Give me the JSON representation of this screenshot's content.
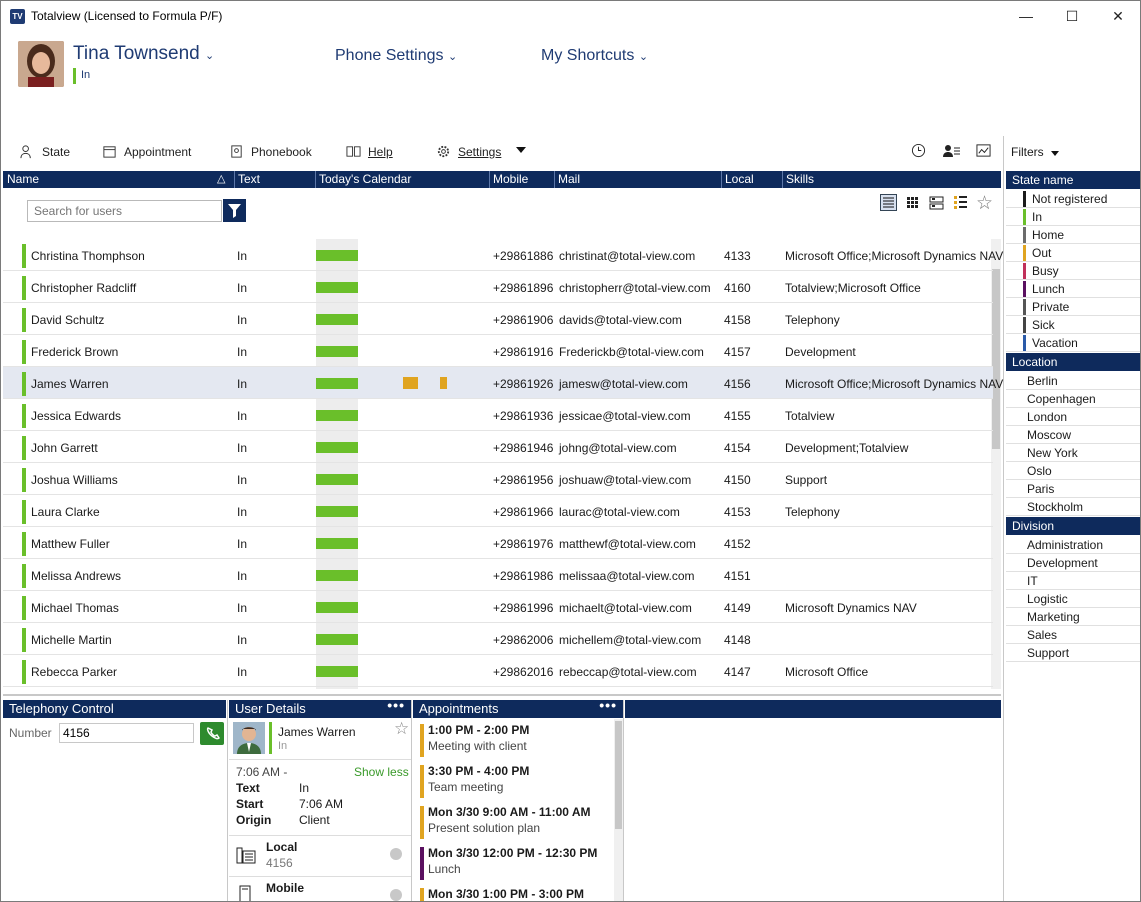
{
  "window": {
    "title": "Totalview  (Licensed to Formula P/F)",
    "icon_label": "TV",
    "minimize": "—",
    "maximize": "☐",
    "close": "✕"
  },
  "header": {
    "user_name": "Tina Townsend",
    "user_status": "In",
    "phone_settings": "Phone Settings",
    "my_shortcuts": "My Shortcuts"
  },
  "toolbar": {
    "state": "State",
    "appointment": "Appointment",
    "phonebook": "Phonebook",
    "help": "Help",
    "settings": "Settings",
    "filters": "Filters"
  },
  "grid": {
    "columns": [
      "Name",
      "Text",
      "Today's Calendar",
      "Mobile",
      "Mail",
      "Local",
      "Skills"
    ],
    "search_placeholder": "Search for users",
    "rows": [
      {
        "name": "Christina Thomphson",
        "text": "In",
        "mobile": "+29861886",
        "mail": "christinat@total-view.com",
        "local": "4133",
        "skills": "Microsoft Office;Microsoft Dynamics NAV"
      },
      {
        "name": "Christopher Radcliff",
        "text": "In",
        "mobile": "+29861896",
        "mail": "christopherr@total-view.com",
        "local": "4160",
        "skills": "Totalview;Microsoft Office"
      },
      {
        "name": "David Schultz",
        "text": "In",
        "mobile": "+29861906",
        "mail": "davids@total-view.com",
        "local": "4158",
        "skills": "Telephony"
      },
      {
        "name": "Frederick Brown",
        "text": "In",
        "mobile": "+29861916",
        "mail": "Frederickb@total-view.com",
        "local": "4157",
        "skills": "Development"
      },
      {
        "name": "James Warren",
        "text": "In",
        "mobile": "+29861926",
        "mail": "jamesw@total-view.com",
        "local": "4156",
        "skills": "Microsoft Office;Microsoft Dynamics NAV"
      },
      {
        "name": "Jessica Edwards",
        "text": "In",
        "mobile": "+29861936",
        "mail": "jessicae@total-view.com",
        "local": "4155",
        "skills": "Totalview"
      },
      {
        "name": "John Garrett",
        "text": "In",
        "mobile": "+29861946",
        "mail": "johng@total-view.com",
        "local": "4154",
        "skills": "Development;Totalview"
      },
      {
        "name": "Joshua Williams",
        "text": "In",
        "mobile": "+29861956",
        "mail": "joshuaw@total-view.com",
        "local": "4150",
        "skills": "Support"
      },
      {
        "name": "Laura Clarke",
        "text": "In",
        "mobile": "+29861966",
        "mail": "laurac@total-view.com",
        "local": "4153",
        "skills": "Telephony"
      },
      {
        "name": "Matthew Fuller",
        "text": "In",
        "mobile": "+29861976",
        "mail": "matthewf@total-view.com",
        "local": "4152",
        "skills": ""
      },
      {
        "name": "Melissa Andrews",
        "text": "In",
        "mobile": "+29861986",
        "mail": "melissaa@total-view.com",
        "local": "4151",
        "skills": ""
      },
      {
        "name": "Michael Thomas",
        "text": "In",
        "mobile": "+29861996",
        "mail": "michaelt@total-view.com",
        "local": "4149",
        "skills": "Microsoft Dynamics NAV"
      },
      {
        "name": "Michelle Martin",
        "text": "In",
        "mobile": "+29862006",
        "mail": "michellem@total-view.com",
        "local": "4148",
        "skills": ""
      },
      {
        "name": "Rebecca Parker",
        "text": "In",
        "mobile": "+29862016",
        "mail": "rebeccap@total-view.com",
        "local": "4147",
        "skills": "Microsoft Office"
      }
    ]
  },
  "filters": {
    "state_title": "State name",
    "states": [
      {
        "label": "Not registered",
        "color": "#1a1a1a"
      },
      {
        "label": "In",
        "color": "#6abf2a"
      },
      {
        "label": "Home",
        "color": "#6b6b6b"
      },
      {
        "label": "Out",
        "color": "#e0a420"
      },
      {
        "label": "Busy",
        "color": "#c0305a"
      },
      {
        "label": "Lunch",
        "color": "#5a1060"
      },
      {
        "label": "Private",
        "color": "#555555"
      },
      {
        "label": "Sick",
        "color": "#444444"
      },
      {
        "label": "Vacation",
        "color": "#2a5aa8"
      }
    ],
    "location_title": "Location",
    "locations": [
      "Berlin",
      "Copenhagen",
      "London",
      "Moscow",
      "New York",
      "Oslo",
      "Paris",
      "Stockholm"
    ],
    "division_title": "Division",
    "divisions": [
      "Administration",
      "Development",
      "IT",
      "Logistic",
      "Marketing",
      "Sales",
      "Support"
    ]
  },
  "telephony": {
    "title": "Telephony Control",
    "number_label": "Number",
    "number_value": "4156"
  },
  "user_details": {
    "title": "User Details",
    "name": "James Warren",
    "status": "In",
    "since": "7:06 AM -",
    "show_less": "Show less",
    "text_label": "Text",
    "text_value": "In",
    "start_label": "Start",
    "start_value": "7:06 AM",
    "origin_label": "Origin",
    "origin_value": "Client",
    "local_label": "Local",
    "local_value": "4156",
    "mobile_label": "Mobile"
  },
  "appointments": {
    "title": "Appointments",
    "items": [
      {
        "time": "1:00  PM - 2:00 PM",
        "subject": "Meeting with client",
        "color": "#e0a420"
      },
      {
        "time": "3:30  PM - 4:00 PM",
        "subject": "Team meeting",
        "color": "#e0a420"
      },
      {
        "time": "Mon 3/30  9:00 AM - 11:00 AM",
        "subject": "Present solution plan",
        "color": "#e0a420"
      },
      {
        "time": "Mon 3/30  12:00 PM - 12:30 PM",
        "subject": "Lunch",
        "color": "#5a1060"
      },
      {
        "time": "Mon 3/30  1:00 PM - 3:00 PM",
        "subject": "",
        "color": "#e0a420"
      }
    ]
  },
  "colors": {
    "accent": "#0e2a5c",
    "status_in": "#6abf2a"
  }
}
